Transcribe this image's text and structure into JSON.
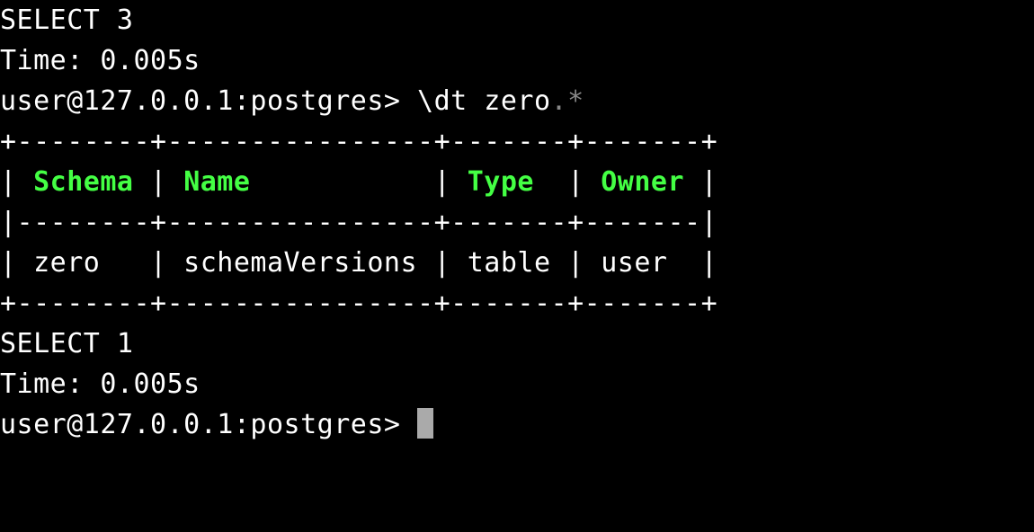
{
  "prev_result": {
    "select": "SELECT 3",
    "time": "Time: 0.005s"
  },
  "prompt1": {
    "text": "user@127.0.0.1:postgres> ",
    "command_prefix": "\\dt zero",
    "command_dot_star": ".*"
  },
  "table": {
    "border_top": "+--------+----------------+-------+-------+",
    "header_pipe1": "| ",
    "header_schema": "Schema",
    "header_pipe2": " | ",
    "header_name": "Name",
    "header_pad_name": "           ",
    "header_pipe3": "| ",
    "header_type": "Type",
    "header_pipe4": "  | ",
    "header_owner": "Owner",
    "header_pipe5": " |",
    "border_mid": "|--------+----------------+-------+-------|",
    "row_text": "| zero   | schemaVersions | table | user  |",
    "border_bot": "+--------+----------------+-------+-------+"
  },
  "result": {
    "select": "SELECT 1",
    "time": "Time: 0.005s"
  },
  "prompt2": {
    "text": "user@127.0.0.1:postgres> "
  },
  "chart_data": {
    "type": "table",
    "title": "\\dt zero.*",
    "columns": [
      "Schema",
      "Name",
      "Type",
      "Owner"
    ],
    "rows": [
      [
        "zero",
        "schemaVersions",
        "table",
        "user"
      ]
    ]
  }
}
